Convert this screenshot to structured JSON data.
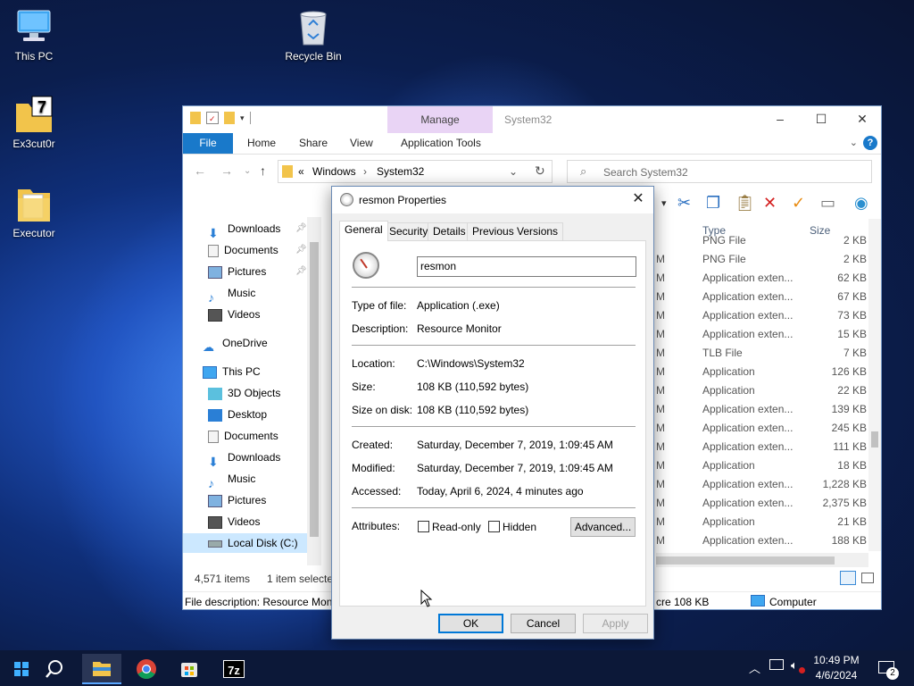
{
  "desktop": {
    "icons": [
      {
        "label": "This PC",
        "icon": "computer-icon"
      },
      {
        "label": "Recycle Bin",
        "icon": "recycle-bin-icon"
      },
      {
        "label": "Ex3cut0r",
        "icon": "7zip-folder-icon"
      },
      {
        "label": "Executor",
        "icon": "folder-icon"
      }
    ]
  },
  "explorer": {
    "title": "System32",
    "contextual_tab": "Manage",
    "ribbon_tabs": [
      "File",
      "Home",
      "Share",
      "View",
      "Application Tools"
    ],
    "breadcrumb": [
      "Windows",
      "System32"
    ],
    "breadcrumb_prefix": "«",
    "search_placeholder": "Search System32",
    "nav": {
      "quick_access": [
        {
          "label": "Downloads",
          "icon": "download-arrow-icon",
          "pinned": true
        },
        {
          "label": "Documents",
          "icon": "document-icon",
          "pinned": true
        },
        {
          "label": "Pictures",
          "icon": "pictures-icon",
          "pinned": true
        },
        {
          "label": "Music",
          "icon": "music-note-icon",
          "pinned": false
        },
        {
          "label": "Videos",
          "icon": "film-icon",
          "pinned": false
        }
      ],
      "onedrive": "OneDrive",
      "this_pc": "This PC",
      "this_pc_items": [
        {
          "label": "3D Objects",
          "icon": "cube-icon"
        },
        {
          "label": "Desktop",
          "icon": "desktop-icon"
        },
        {
          "label": "Documents",
          "icon": "document-icon"
        },
        {
          "label": "Downloads",
          "icon": "download-arrow-icon"
        },
        {
          "label": "Music",
          "icon": "music-note-icon"
        },
        {
          "label": "Pictures",
          "icon": "pictures-icon"
        },
        {
          "label": "Videos",
          "icon": "film-icon"
        },
        {
          "label": "Local Disk (C:)",
          "icon": "drive-icon"
        }
      ]
    },
    "columns": {
      "type": "Type",
      "size": "Size"
    },
    "files": [
      {
        "type": "PNG File",
        "size": "2 KB"
      },
      {
        "type": "PNG File",
        "size": "2 KB"
      },
      {
        "type": "Application exten...",
        "size": "62 KB"
      },
      {
        "type": "Application exten...",
        "size": "67 KB"
      },
      {
        "type": "Application exten...",
        "size": "73 KB"
      },
      {
        "type": "Application exten...",
        "size": "15 KB"
      },
      {
        "type": "TLB File",
        "size": "7 KB"
      },
      {
        "type": "Application",
        "size": "126 KB"
      },
      {
        "type": "Application",
        "size": "22 KB"
      },
      {
        "type": "Application exten...",
        "size": "139 KB"
      },
      {
        "type": "Application exten...",
        "size": "245 KB"
      },
      {
        "type": "Application exten...",
        "size": "111 KB"
      },
      {
        "type": "Application",
        "size": "18 KB"
      },
      {
        "type": "Application exten...",
        "size": "1,228 KB"
      },
      {
        "type": "Application exten...",
        "size": "2,375 KB"
      },
      {
        "type": "Application",
        "size": "21 KB"
      },
      {
        "type": "Application exten...",
        "size": "188 KB"
      }
    ],
    "status": {
      "count": "4,571 items",
      "selected": "1 item selecte"
    },
    "desc_bar": {
      "description": "File description: Resource Moni",
      "size_fragment": "cre 108 KB",
      "location": "Computer"
    }
  },
  "dialog": {
    "title": "resmon Properties",
    "tabs": [
      "General",
      "Security",
      "Details",
      "Previous Versions"
    ],
    "active_tab": "General",
    "filename": "resmon",
    "fields": {
      "type_label": "Type of file:",
      "type_value": "Application (.exe)",
      "desc_label": "Description:",
      "desc_value": "Resource Monitor",
      "loc_label": "Location:",
      "loc_value": "C:\\Windows\\System32",
      "size_label": "Size:",
      "size_value": "108 KB (110,592 bytes)",
      "disk_label": "Size on disk:",
      "disk_value": "108 KB (110,592 bytes)",
      "created_label": "Created:",
      "created_value": "Saturday, December 7, 2019, 1:09:45 AM",
      "modified_label": "Modified:",
      "modified_value": "Saturday, December 7, 2019, 1:09:45 AM",
      "accessed_label": "Accessed:",
      "accessed_value": "Today, April 6, 2024, 4 minutes ago",
      "attr_label": "Attributes:",
      "readonly": "Read-only",
      "hidden": "Hidden",
      "advanced": "Advanced..."
    },
    "buttons": {
      "ok": "OK",
      "cancel": "Cancel",
      "apply": "Apply"
    }
  },
  "taskbar": {
    "time": "10:49 PM",
    "date": "4/6/2024",
    "notifications": "2",
    "pinned": [
      "windows-start-icon",
      "search-icon",
      "file-explorer-icon",
      "chrome-icon",
      "store-icon",
      "7zip-icon"
    ]
  },
  "colors": {
    "accent": "#1979ca",
    "manage_tab": "#e9d4f5",
    "taskbar": "#0c1838",
    "delete_red": "#d42020",
    "check_orange": "#e88a10"
  }
}
